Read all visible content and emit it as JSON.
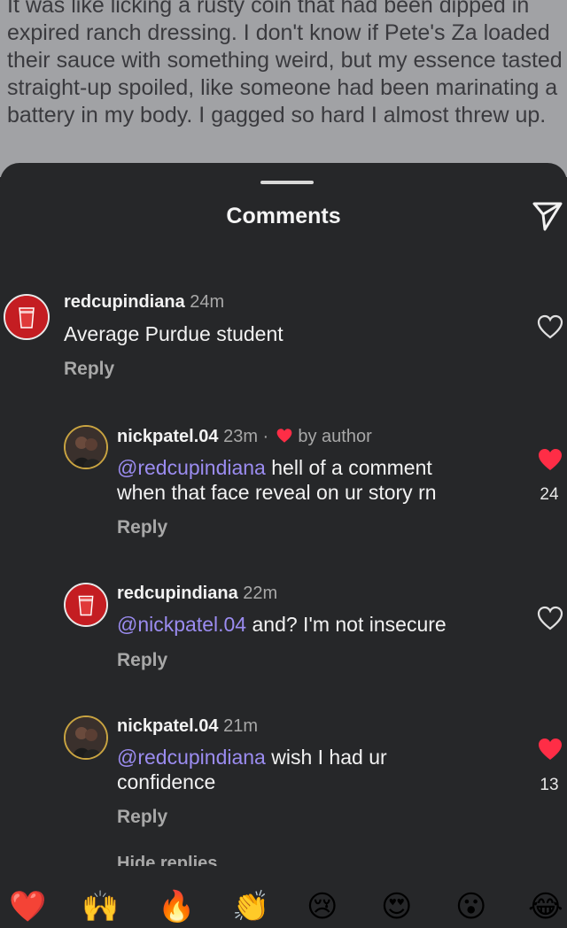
{
  "story": {
    "text": "It was like licking a rusty coin that had been dipped in expired ranch dressing. I don't know if Pete's Za loaded their sauce with something weird, but my essence tasted straight-up spoiled, like someone had been marinating a battery in my body. I gagged so hard I almost threw up."
  },
  "sheet": {
    "title": "Comments",
    "send_icon": "send-icon"
  },
  "comments": [
    {
      "username": "redcupindiana",
      "time": "24m",
      "body": "Average Purdue student",
      "reply": "Reply",
      "liked": false
    },
    {
      "username": "nickpatel.04",
      "time": "23m",
      "dot": "·",
      "author_badge": "by author",
      "mention": "@redcupindiana",
      "body_line1": "hell of a comment",
      "body_line2": "when that face reveal on ur story rn",
      "reply": "Reply",
      "liked": true,
      "like_count": "24"
    },
    {
      "username": "redcupindiana",
      "time": "22m",
      "mention": "@nickpatel.04",
      "body": "and? I'm not insecure",
      "reply": "Reply",
      "liked": false
    },
    {
      "username": "nickpatel.04",
      "time": "21m",
      "mention": "@redcupindiana",
      "body_line1": "wish I had ur",
      "body_line2": "confidence",
      "reply": "Reply",
      "liked": true,
      "like_count": "13"
    }
  ],
  "hide_replies": "Hide replies",
  "reactions": [
    "❤️",
    "🙌",
    "🔥",
    "👏",
    "😢",
    "😍",
    "😮",
    "😂"
  ],
  "colors": {
    "accent_mention": "#9b8cf0",
    "like_red": "#ff2d46",
    "background": "#262729"
  }
}
